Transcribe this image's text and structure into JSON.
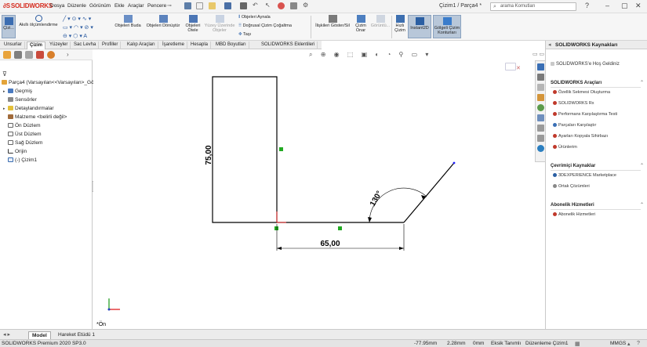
{
  "app": {
    "logo_text": "SOLIDWORKS",
    "doc_title": "Çizim1 / Parça4 *",
    "search_placeholder": "arama Komutları"
  },
  "menu": [
    "Dosya",
    "Düzenle",
    "Görünüm",
    "Ekle",
    "Araçlar",
    "Pencere"
  ],
  "ribbon": {
    "cizim": "Çizi...",
    "akilli_olcu": "Akıllı ölçümlendirme",
    "objeleri_buda": "Objeleri Buda",
    "objeleri_donustur": "Objeleri Dönüştür",
    "objeleri_otele": "Objeleri Ötele",
    "yuzey_uzerinde": "Yüzey Üzerinde Objeler",
    "objeleri_aynala": "Objeleri Aynala",
    "dogrusal_cogaltma": "Doğrusal Çizim Çoğaltma",
    "tasi": "Taşı",
    "iliskileri_goster": "İlişkileri Göster/Sil",
    "cizim_onar": "Çizim Onar",
    "hizli_goruntu": "Görüntü...",
    "hizli_cizim": "Hızlı Çizim",
    "instant2d": "Instant2D",
    "golgeli_cizim": "Gölgeli Çizim Konturları"
  },
  "tabs": [
    "Unsurlar",
    "Çizim",
    "Yüzeyler",
    "Sac Levha",
    "Profiller",
    "Kalıp Araçları",
    "İşaretleme",
    "Hesapla",
    "MBD Boyutları",
    "SOLIDWORKS Eklentileri"
  ],
  "active_tab": "Çizim",
  "tree": {
    "root": "Parça4  (Varsayılan<<Varsayılan>_Gö",
    "items": [
      "Geçmiş",
      "Sensörler",
      "Detaylandırmalar",
      "Malzeme <belirli değil>",
      "Ön Düzlem",
      "Üst Düzlem",
      "Sağ Düzlem",
      "Orijin",
      "(-) Çizim1"
    ]
  },
  "sketch": {
    "dim_vertical": "75,00",
    "dim_horizontal": "65,00",
    "dim_angle": "130°"
  },
  "view_label": "*Ön",
  "rightpanel": {
    "title": "SOLIDWORKS Kaynakları",
    "welcome": "SOLIDWORKS'e Hoş Geldiniz",
    "section_tools": "SOLIDWORKS Araçları",
    "tools": [
      "Özellik Sekmesi Oluşturma",
      "SOLIDWORKS Rx",
      "Performans Karşılaştırma Testi",
      "Parçaları Karşılaştır",
      "Ayarları Kopyala Sihirbazı",
      "Ürünlerim"
    ],
    "section_online": "Çevrimiçi Kaynaklar",
    "online": [
      "3DEXPERIENCE Marketplace",
      "Ortak Çözümleri"
    ],
    "section_sub": "Abonelik Hizmetleri",
    "sub": [
      "Abonelik Hizmetleri"
    ]
  },
  "bottom_tabs": [
    "Model",
    "Hareket Etüdü 1"
  ],
  "status": {
    "product": "SOLIDWORKS Premium 2020 SP3.0",
    "x": "-77.95mm",
    "y": "2.28mm",
    "z": "0mm",
    "state": "Eksik Tanımlı",
    "editing": "Düzenleme Çizim1",
    "units": "MMGS"
  },
  "colors": {
    "brand_red": "#d52b1e",
    "sketch_line": "#000000",
    "relation_green": "#22aa22",
    "origin_red": "#e02020",
    "highlight": "#b8c7d9"
  }
}
